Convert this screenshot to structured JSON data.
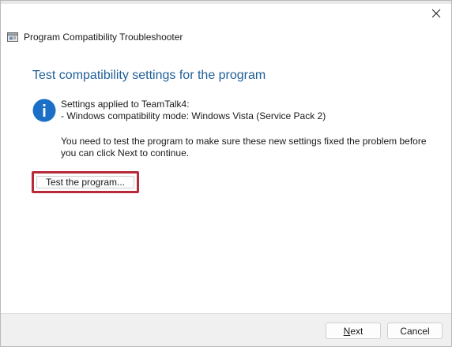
{
  "window": {
    "title": "Program Compatibility Troubleshooter"
  },
  "content": {
    "heading": "Test compatibility settings for the program",
    "settings_line_1": "Settings applied to TeamTalk4:",
    "settings_line_2": "- Windows compatibility mode: Windows Vista (Service Pack 2)",
    "note_line_1": "You need to test the program to make sure these new settings fixed the problem before",
    "note_line_2": "you can click Next to continue.",
    "test_button_label": "Test the program..."
  },
  "footer": {
    "next_mnemonic": "N",
    "next_rest": "ext",
    "cancel_label": "Cancel"
  },
  "colors": {
    "heading": "#1f5e98",
    "info_icon": "#1c6fc6",
    "highlight_border": "#b62a3a"
  },
  "icons": {
    "close": "close-icon",
    "app": "troubleshooter-app-icon",
    "info": "info-icon"
  }
}
